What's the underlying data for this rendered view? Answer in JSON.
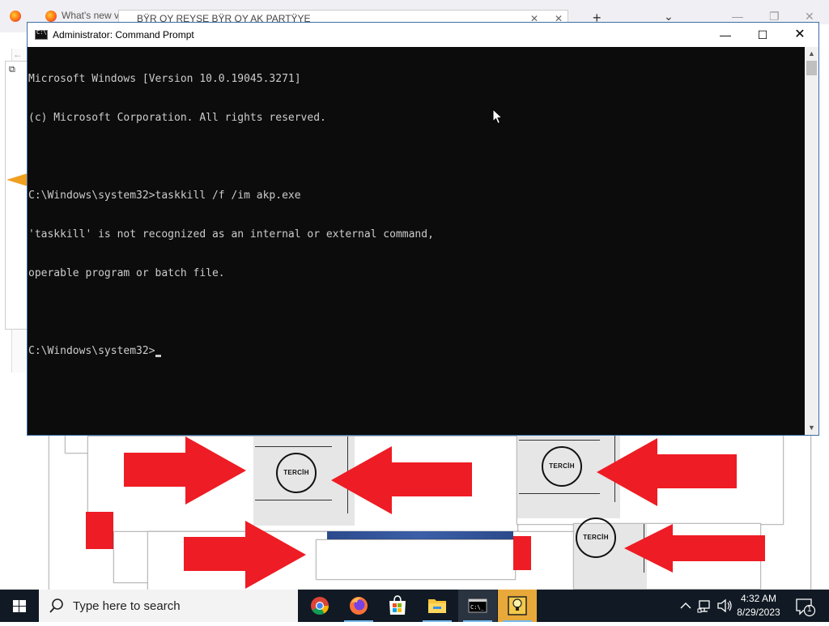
{
  "background_browser": {
    "tab1_title": "What's new v",
    "tab2_title": "BŸR OY REYSE BŸR OY AK PARTŸYE"
  },
  "stamps": [
    "TERCİH",
    "TERCİH",
    "TERCİH"
  ],
  "cmd": {
    "title": "Administrator:  Command Prompt",
    "lines": [
      "Microsoft Windows [Version 10.0.19045.3271]",
      "(c) Microsoft Corporation. All rights reserved.",
      "",
      "C:\\Windows\\system32>taskkill /f /im akp.exe",
      "'taskkill' is not recognized as an internal or external command,",
      "operable program or batch file.",
      ""
    ],
    "prompt": "C:\\Windows\\system32>"
  },
  "taskbar": {
    "search_placeholder": "Type here to search",
    "apps": [
      "chrome-icon",
      "firefox-icon",
      "store-icon",
      "file-explorer-icon",
      "cmd-icon",
      "lightbulb-app-icon"
    ],
    "clock_time": "4:32 AM",
    "clock_date": "8/29/2023",
    "notification_count": "1"
  },
  "colors": {
    "arrow_red": "#ee1c24",
    "console_bg": "#0c0c0c",
    "console_text": "#cccccc",
    "taskbar_bg": "#111a24"
  }
}
